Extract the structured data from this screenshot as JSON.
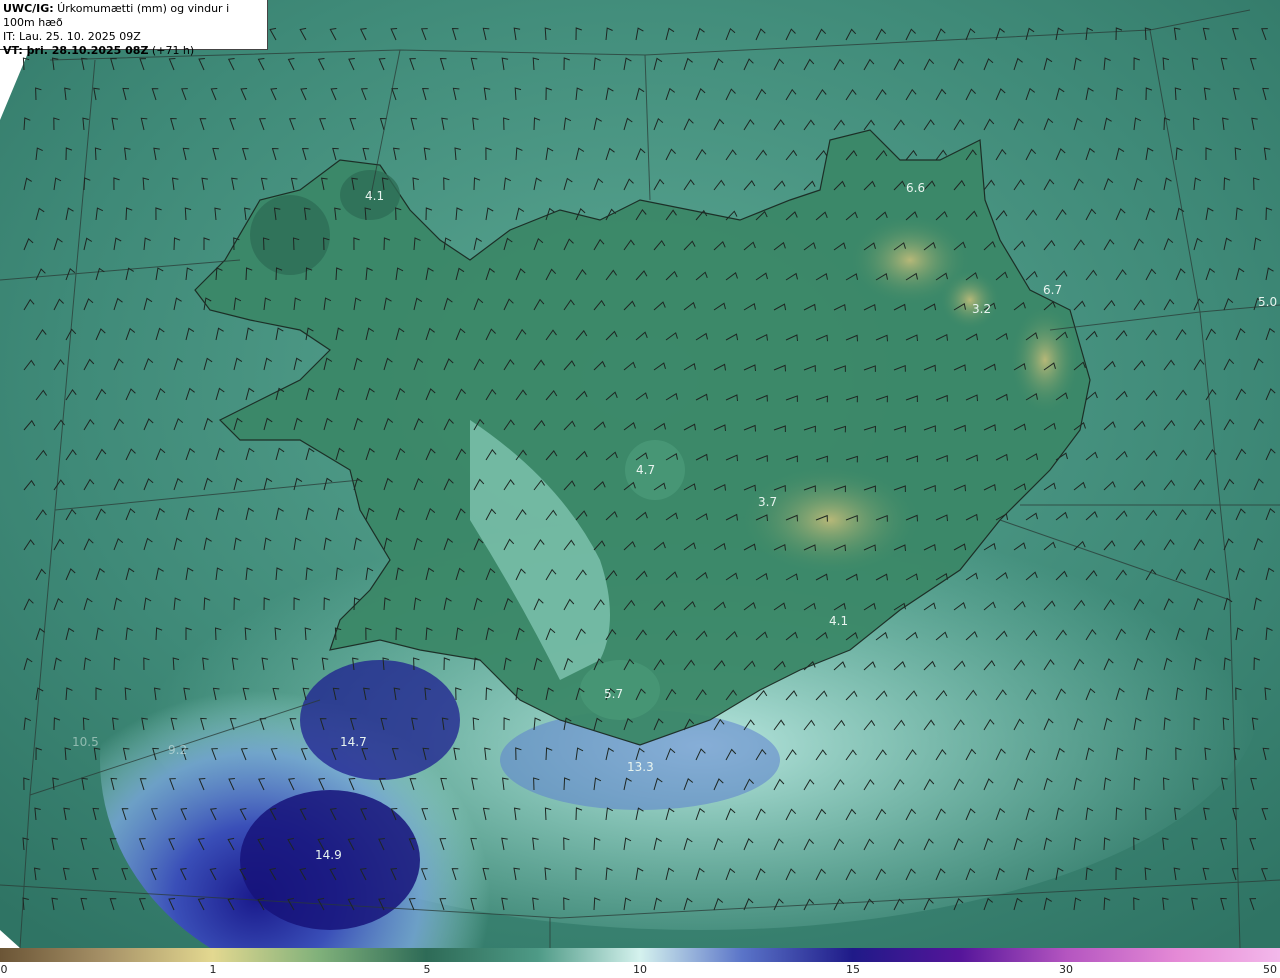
{
  "header": {
    "line1_bold": "UWC/IG:",
    "line1_text": " Úrkomumætti (mm) og vindur i 100m hæð",
    "line2": "IT: Lau. 25. 10. 2025 09Z",
    "line3_bold": "VT: þri. 28.10.2025 08Z",
    "line3_text": " (+71 h)"
  },
  "map_labels": [
    "4.1",
    "6.6",
    "6.7",
    "3.2",
    "5.0",
    "4.7",
    "3.7",
    "4.1",
    "5.7",
    "13.3",
    "14.7",
    "14.9",
    "10.5",
    "9.2"
  ],
  "colorbar": {
    "ticks": [
      "0",
      "1",
      "5",
      "10",
      "15",
      "30",
      "50"
    ],
    "colors": [
      "#6b5536",
      "#a59066",
      "#e3d890",
      "#4d8b64",
      "#2e6b57",
      "#7fcab3",
      "#d5f2ee",
      "#5a74c8",
      "#1f1a88",
      "#55159a",
      "#b455c0",
      "#e58ad6",
      "#f3b8ea"
    ]
  },
  "palette": {
    "sea": "#3f8a78",
    "land": "#2f7058",
    "heavy_precip": "#2a2aa0",
    "light_precip": "#a8e6dc"
  }
}
